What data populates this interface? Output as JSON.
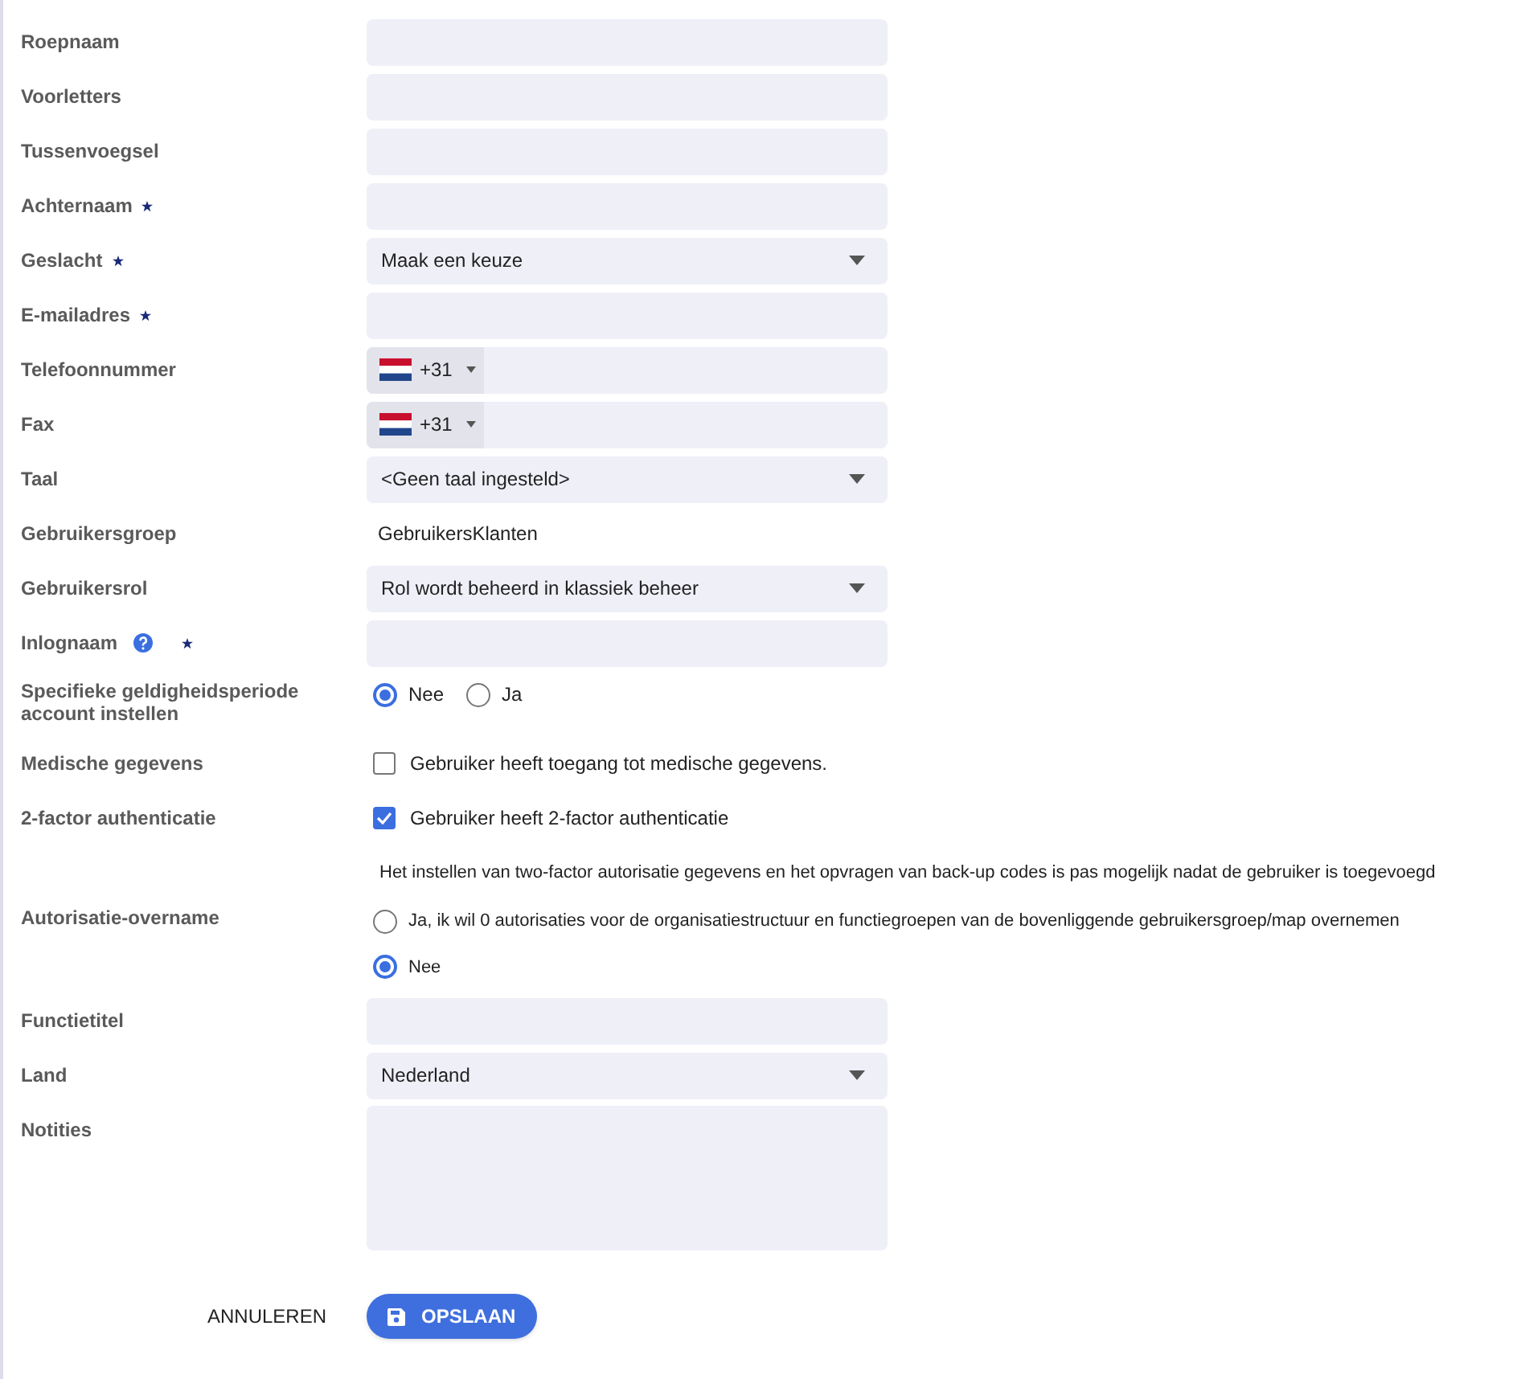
{
  "fields": [
    {
      "kind": "text",
      "label": "Roepnaam",
      "required": false
    },
    {
      "kind": "text",
      "label": "Voorletters",
      "required": false
    },
    {
      "kind": "text",
      "label": "Tussenvoegsel",
      "required": false
    },
    {
      "kind": "text",
      "label": "Achternaam",
      "required": true
    },
    {
      "kind": "select",
      "label": "Geslacht",
      "required": true,
      "value": "Maak een keuze"
    },
    {
      "kind": "text",
      "label": "E-mailadres",
      "required": true
    },
    {
      "kind": "phone",
      "label": "Telefoonnummer",
      "required": false,
      "code": "+31"
    },
    {
      "kind": "phone",
      "label": "Fax",
      "required": false,
      "code": "+31"
    },
    {
      "kind": "select",
      "label": "Taal",
      "required": false,
      "value": "<Geen taal ingesteld>"
    },
    {
      "kind": "static",
      "label": "Gebruikersgroep",
      "required": false,
      "value": "GebruikersKlanten"
    },
    {
      "kind": "select",
      "label": "Gebruikersrol",
      "required": false,
      "value": "Rol wordt beheerd in klassiek beheer"
    },
    {
      "kind": "text",
      "label": "Inlognaam",
      "required": true,
      "help": true
    },
    {
      "kind": "radio",
      "label": "Specifieke geldigheidsperiode account instellen",
      "required": false,
      "options": [
        {
          "label": "Nee",
          "selected": true
        },
        {
          "label": "Ja",
          "selected": false
        }
      ]
    },
    {
      "kind": "checkbox",
      "label": "Medische gegevens",
      "required": false,
      "text": "Gebruiker heeft toegang tot medische gegevens.",
      "checked": false
    },
    {
      "kind": "checkbox",
      "label": "2-factor authenticatie",
      "required": false,
      "text": "Gebruiker heeft 2-factor authenticatie",
      "checked": true
    },
    {
      "kind": "note",
      "text": "Het instellen van two-factor autorisatie gegevens en het opvragen van back-up codes is pas mogelijk nadat de gebruiker is toegevoegd"
    },
    {
      "kind": "radio_vertical",
      "label": "Autorisatie-overname",
      "required": false,
      "options": [
        {
          "label": "Ja, ik wil 0 autorisaties voor de organisatiestructuur en functiegroepen van de bovenliggende gebruikersgroep/map overnemen",
          "selected": false
        },
        {
          "label": "Nee",
          "selected": true
        }
      ]
    },
    {
      "kind": "text",
      "label": "Functietitel",
      "required": false
    },
    {
      "kind": "select",
      "label": "Land",
      "required": false,
      "value": "Nederland"
    },
    {
      "kind": "textarea",
      "label": "Notities",
      "required": false
    }
  ],
  "buttons": {
    "cancel": "ANNULEREN",
    "save": "OPSLAAN"
  }
}
